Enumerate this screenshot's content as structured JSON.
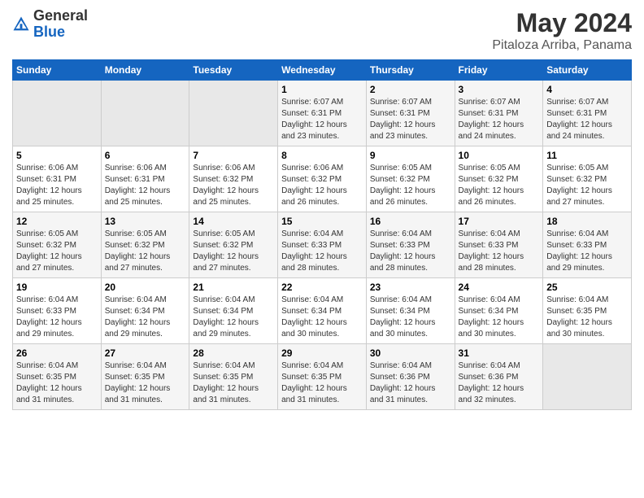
{
  "header": {
    "logo_general": "General",
    "logo_blue": "Blue",
    "title": "May 2024",
    "subtitle": "Pitaloza Arriba, Panama"
  },
  "calendar": {
    "weekdays": [
      "Sunday",
      "Monday",
      "Tuesday",
      "Wednesday",
      "Thursday",
      "Friday",
      "Saturday"
    ],
    "weeks": [
      [
        {
          "day": "",
          "info": ""
        },
        {
          "day": "",
          "info": ""
        },
        {
          "day": "",
          "info": ""
        },
        {
          "day": "1",
          "info": "Sunrise: 6:07 AM\nSunset: 6:31 PM\nDaylight: 12 hours\nand 23 minutes."
        },
        {
          "day": "2",
          "info": "Sunrise: 6:07 AM\nSunset: 6:31 PM\nDaylight: 12 hours\nand 23 minutes."
        },
        {
          "day": "3",
          "info": "Sunrise: 6:07 AM\nSunset: 6:31 PM\nDaylight: 12 hours\nand 24 minutes."
        },
        {
          "day": "4",
          "info": "Sunrise: 6:07 AM\nSunset: 6:31 PM\nDaylight: 12 hours\nand 24 minutes."
        }
      ],
      [
        {
          "day": "5",
          "info": "Sunrise: 6:06 AM\nSunset: 6:31 PM\nDaylight: 12 hours\nand 25 minutes."
        },
        {
          "day": "6",
          "info": "Sunrise: 6:06 AM\nSunset: 6:31 PM\nDaylight: 12 hours\nand 25 minutes."
        },
        {
          "day": "7",
          "info": "Sunrise: 6:06 AM\nSunset: 6:32 PM\nDaylight: 12 hours\nand 25 minutes."
        },
        {
          "day": "8",
          "info": "Sunrise: 6:06 AM\nSunset: 6:32 PM\nDaylight: 12 hours\nand 26 minutes."
        },
        {
          "day": "9",
          "info": "Sunrise: 6:05 AM\nSunset: 6:32 PM\nDaylight: 12 hours\nand 26 minutes."
        },
        {
          "day": "10",
          "info": "Sunrise: 6:05 AM\nSunset: 6:32 PM\nDaylight: 12 hours\nand 26 minutes."
        },
        {
          "day": "11",
          "info": "Sunrise: 6:05 AM\nSunset: 6:32 PM\nDaylight: 12 hours\nand 27 minutes."
        }
      ],
      [
        {
          "day": "12",
          "info": "Sunrise: 6:05 AM\nSunset: 6:32 PM\nDaylight: 12 hours\nand 27 minutes."
        },
        {
          "day": "13",
          "info": "Sunrise: 6:05 AM\nSunset: 6:32 PM\nDaylight: 12 hours\nand 27 minutes."
        },
        {
          "day": "14",
          "info": "Sunrise: 6:05 AM\nSunset: 6:32 PM\nDaylight: 12 hours\nand 27 minutes."
        },
        {
          "day": "15",
          "info": "Sunrise: 6:04 AM\nSunset: 6:33 PM\nDaylight: 12 hours\nand 28 minutes."
        },
        {
          "day": "16",
          "info": "Sunrise: 6:04 AM\nSunset: 6:33 PM\nDaylight: 12 hours\nand 28 minutes."
        },
        {
          "day": "17",
          "info": "Sunrise: 6:04 AM\nSunset: 6:33 PM\nDaylight: 12 hours\nand 28 minutes."
        },
        {
          "day": "18",
          "info": "Sunrise: 6:04 AM\nSunset: 6:33 PM\nDaylight: 12 hours\nand 29 minutes."
        }
      ],
      [
        {
          "day": "19",
          "info": "Sunrise: 6:04 AM\nSunset: 6:33 PM\nDaylight: 12 hours\nand 29 minutes."
        },
        {
          "day": "20",
          "info": "Sunrise: 6:04 AM\nSunset: 6:34 PM\nDaylight: 12 hours\nand 29 minutes."
        },
        {
          "day": "21",
          "info": "Sunrise: 6:04 AM\nSunset: 6:34 PM\nDaylight: 12 hours\nand 29 minutes."
        },
        {
          "day": "22",
          "info": "Sunrise: 6:04 AM\nSunset: 6:34 PM\nDaylight: 12 hours\nand 30 minutes."
        },
        {
          "day": "23",
          "info": "Sunrise: 6:04 AM\nSunset: 6:34 PM\nDaylight: 12 hours\nand 30 minutes."
        },
        {
          "day": "24",
          "info": "Sunrise: 6:04 AM\nSunset: 6:34 PM\nDaylight: 12 hours\nand 30 minutes."
        },
        {
          "day": "25",
          "info": "Sunrise: 6:04 AM\nSunset: 6:35 PM\nDaylight: 12 hours\nand 30 minutes."
        }
      ],
      [
        {
          "day": "26",
          "info": "Sunrise: 6:04 AM\nSunset: 6:35 PM\nDaylight: 12 hours\nand 31 minutes."
        },
        {
          "day": "27",
          "info": "Sunrise: 6:04 AM\nSunset: 6:35 PM\nDaylight: 12 hours\nand 31 minutes."
        },
        {
          "day": "28",
          "info": "Sunrise: 6:04 AM\nSunset: 6:35 PM\nDaylight: 12 hours\nand 31 minutes."
        },
        {
          "day": "29",
          "info": "Sunrise: 6:04 AM\nSunset: 6:35 PM\nDaylight: 12 hours\nand 31 minutes."
        },
        {
          "day": "30",
          "info": "Sunrise: 6:04 AM\nSunset: 6:36 PM\nDaylight: 12 hours\nand 31 minutes."
        },
        {
          "day": "31",
          "info": "Sunrise: 6:04 AM\nSunset: 6:36 PM\nDaylight: 12 hours\nand 32 minutes."
        },
        {
          "day": "",
          "info": ""
        }
      ]
    ]
  }
}
